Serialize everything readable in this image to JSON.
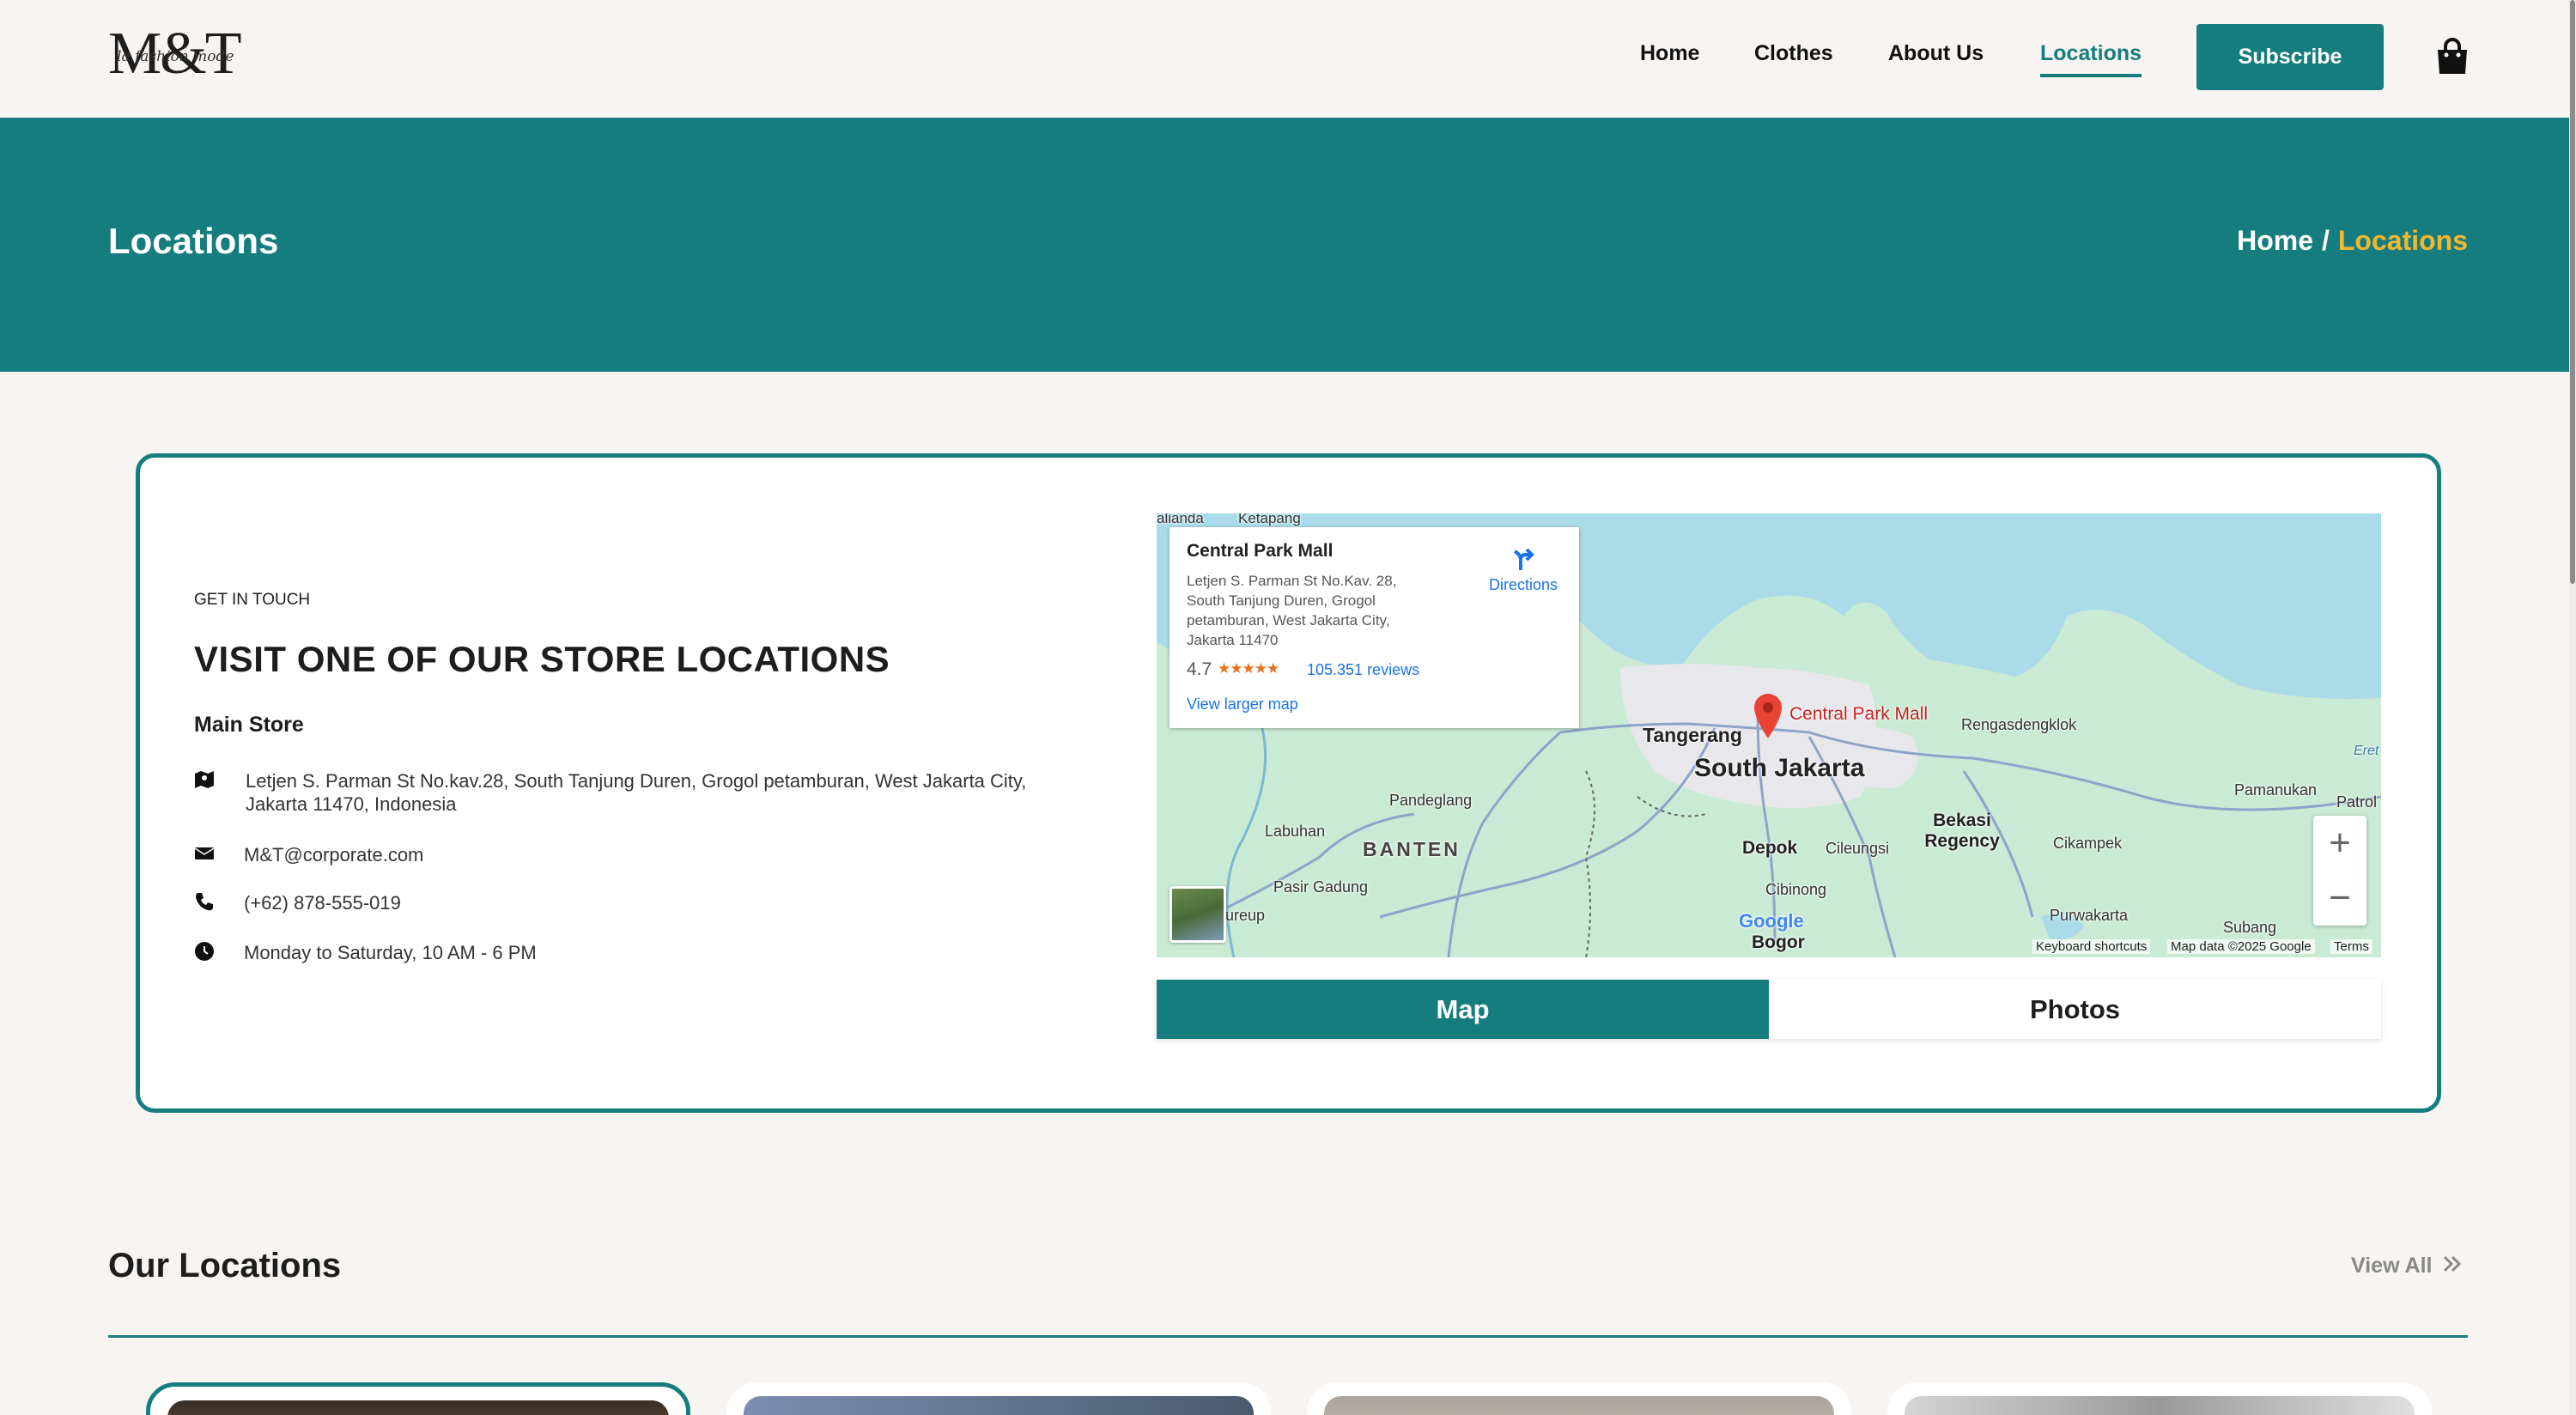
{
  "header": {
    "logo": {
      "mark": "M&T",
      "tagline": "la fashion mode"
    },
    "nav": [
      {
        "label": "Home"
      },
      {
        "label": "Clothes"
      },
      {
        "label": "About Us"
      },
      {
        "label": "Locations",
        "active": true
      }
    ],
    "subscribe_label": "Subscribe",
    "cart_icon": "shopping-bag-icon"
  },
  "hero": {
    "title": "Locations",
    "breadcrumb": {
      "home": "Home",
      "separator": "/",
      "current": "Locations"
    }
  },
  "contact": {
    "eyebrow": "GET IN TOUCH",
    "heading": "VISIT ONE OF OUR STORE LOCATIONS",
    "store_name": "Main Store",
    "address_line1": "Letjen S. Parman St No.kav.28, South Tanjung Duren, Grogol petamburan, West Jakarta City,",
    "address_line2": "Jakarta 11470, Indonesia",
    "email": "M&T@corporate.com",
    "phone": "(+62) 878-555-019",
    "hours": "Monday to Saturday, 10 AM - 6 PM",
    "icons": [
      "map-icon",
      "envelope-icon",
      "phone-icon",
      "clock-icon"
    ]
  },
  "map": {
    "infobox": {
      "title": "Central Park Mall",
      "address": "Letjen S. Parman St No.Kav. 28, South Tanjung Duren, Grogol petamburan, West Jakarta City, Jakarta 11470",
      "rating": "4.7",
      "stars": "★★★★★",
      "reviews": "105.351 reviews",
      "view_larger": "View larger map",
      "directions": "Directions"
    },
    "labels": {
      "top_left": "alianda",
      "ketapang": "Ketapang",
      "pin": "Central Park Mall",
      "tangerang": "Tangerang",
      "south_jakarta": "South Jakarta",
      "rengasdengklok": "Rengasdengklok",
      "pandeglang": "Pandeglang",
      "labuhan": "Labuhan",
      "banten": "BANTEN",
      "depok": "Depok",
      "cileungsi": "Cileungsi",
      "bekasi": "Bekasi Regency",
      "cikampek": "Cikampek",
      "pamanukan": "Pamanukan",
      "patrol": "Patrol",
      "eretan": "Eret",
      "pasir_gadung": "Pasir Gadung",
      "cibinong": "Cibinong",
      "purwakarta": "Purwakarta",
      "subang": "Subang",
      "bogor": "Bogor",
      "jasinga": "ureup"
    },
    "google": "Google",
    "attribution": [
      "Keyboard shortcuts",
      "Map data ©2025 Google",
      "Terms"
    ],
    "zoom_in": "+",
    "zoom_out": "−",
    "colors": {
      "land": "#c9ead4",
      "water": "#a9dbe8",
      "urban": "#e8e8ec",
      "road": "#8fa3c9"
    }
  },
  "tabs": [
    {
      "label": "Map",
      "active": true
    },
    {
      "label": "Photos",
      "active": false
    }
  ],
  "our_locations": {
    "title": "Our Locations",
    "view_all": "View All",
    "view_all_icon": "double-chevron-right-icon"
  },
  "colors": {
    "brand": "#167d7f",
    "accent": "#f2b731",
    "background": "#f7f4f1"
  }
}
